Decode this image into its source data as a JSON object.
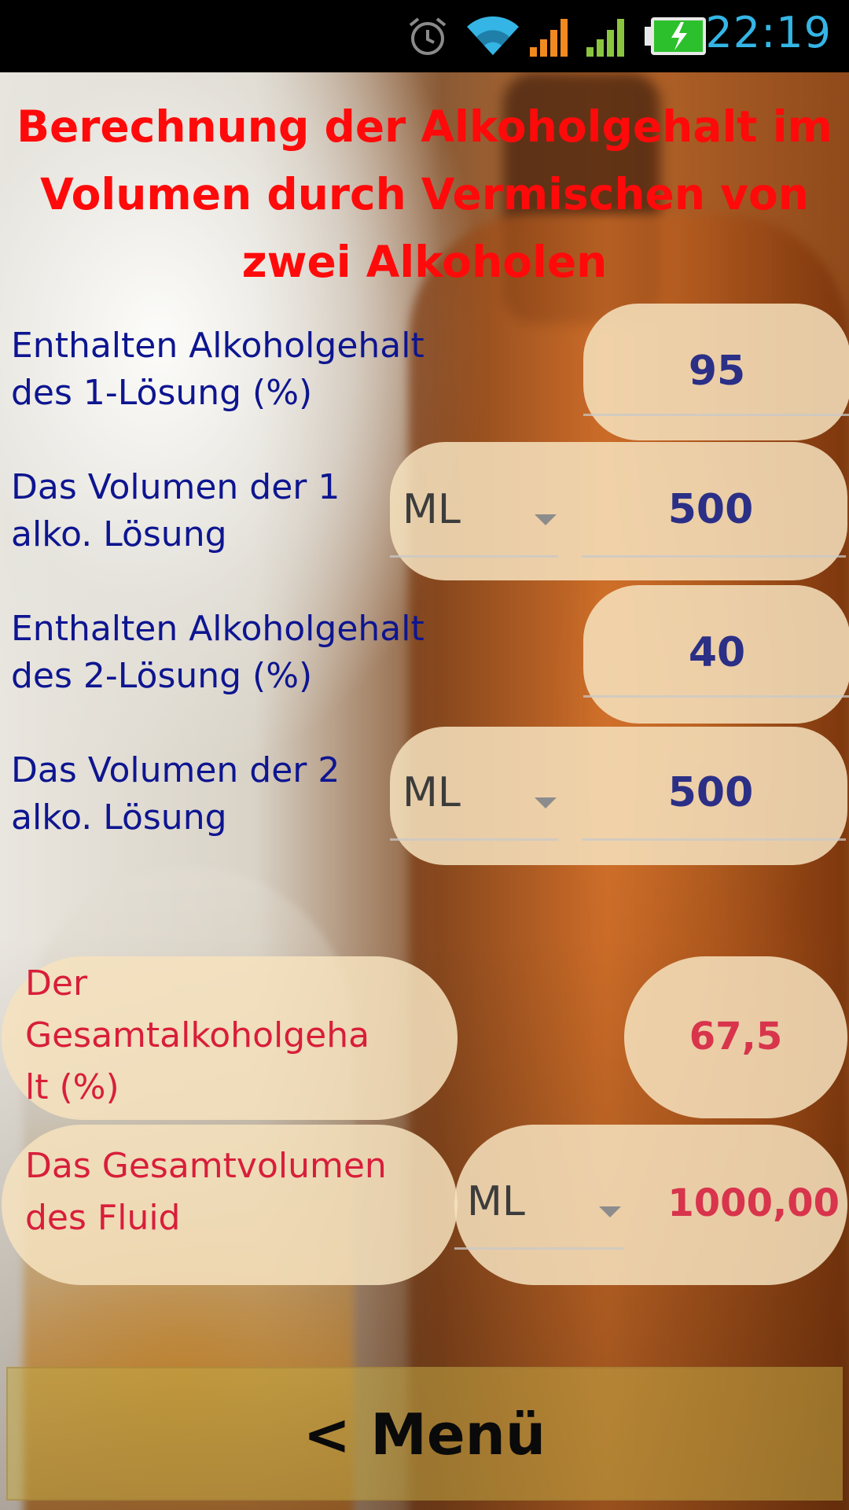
{
  "status_bar": {
    "time": "22:19",
    "icons": [
      "alarm-icon",
      "wifi-icon",
      "signal-orange-icon",
      "signal-green-icon",
      "battery-charging-icon"
    ]
  },
  "title": {
    "line1": "Berechnung der Alkoholgehalt im",
    "line2": "Volumen durch Vermischen von",
    "line3": "zwei Alkoholen"
  },
  "inputs": {
    "alcohol1": {
      "label_line1": "Enthalten Alkoholgehalt",
      "label_line2": "des 1-Lösung (%)",
      "value": "95"
    },
    "volume1": {
      "label_line1": "Das Volumen der 1",
      "label_line2": "alko. Lösung",
      "unit": "ML",
      "value": "500"
    },
    "alcohol2": {
      "label_line1": "Enthalten Alkoholgehalt",
      "label_line2": "des 2-Lösung (%)",
      "value": "40"
    },
    "volume2": {
      "label_line1": "Das Volumen der 2",
      "label_line2": "alko. Lösung",
      "unit": "ML",
      "value": "500"
    }
  },
  "results": {
    "total_alcohol": {
      "label_line1": "Der",
      "label_line2": "Gesamtalkoholgeha",
      "label_line3": "lt (%)",
      "value": "67,5"
    },
    "total_volume": {
      "label_line1": "Das Gesamtvolumen",
      "label_line2": "des Fluid",
      "unit": "ML",
      "value": "1000,00"
    }
  },
  "menu_button": {
    "label": "< Menü"
  },
  "colors": {
    "title": "#ff0a0a",
    "input_label": "#0d1590",
    "input_value": "#2b2f86",
    "result_text": "#d81e3a",
    "pill": "#f6e2be",
    "clock": "#34b5e5"
  }
}
